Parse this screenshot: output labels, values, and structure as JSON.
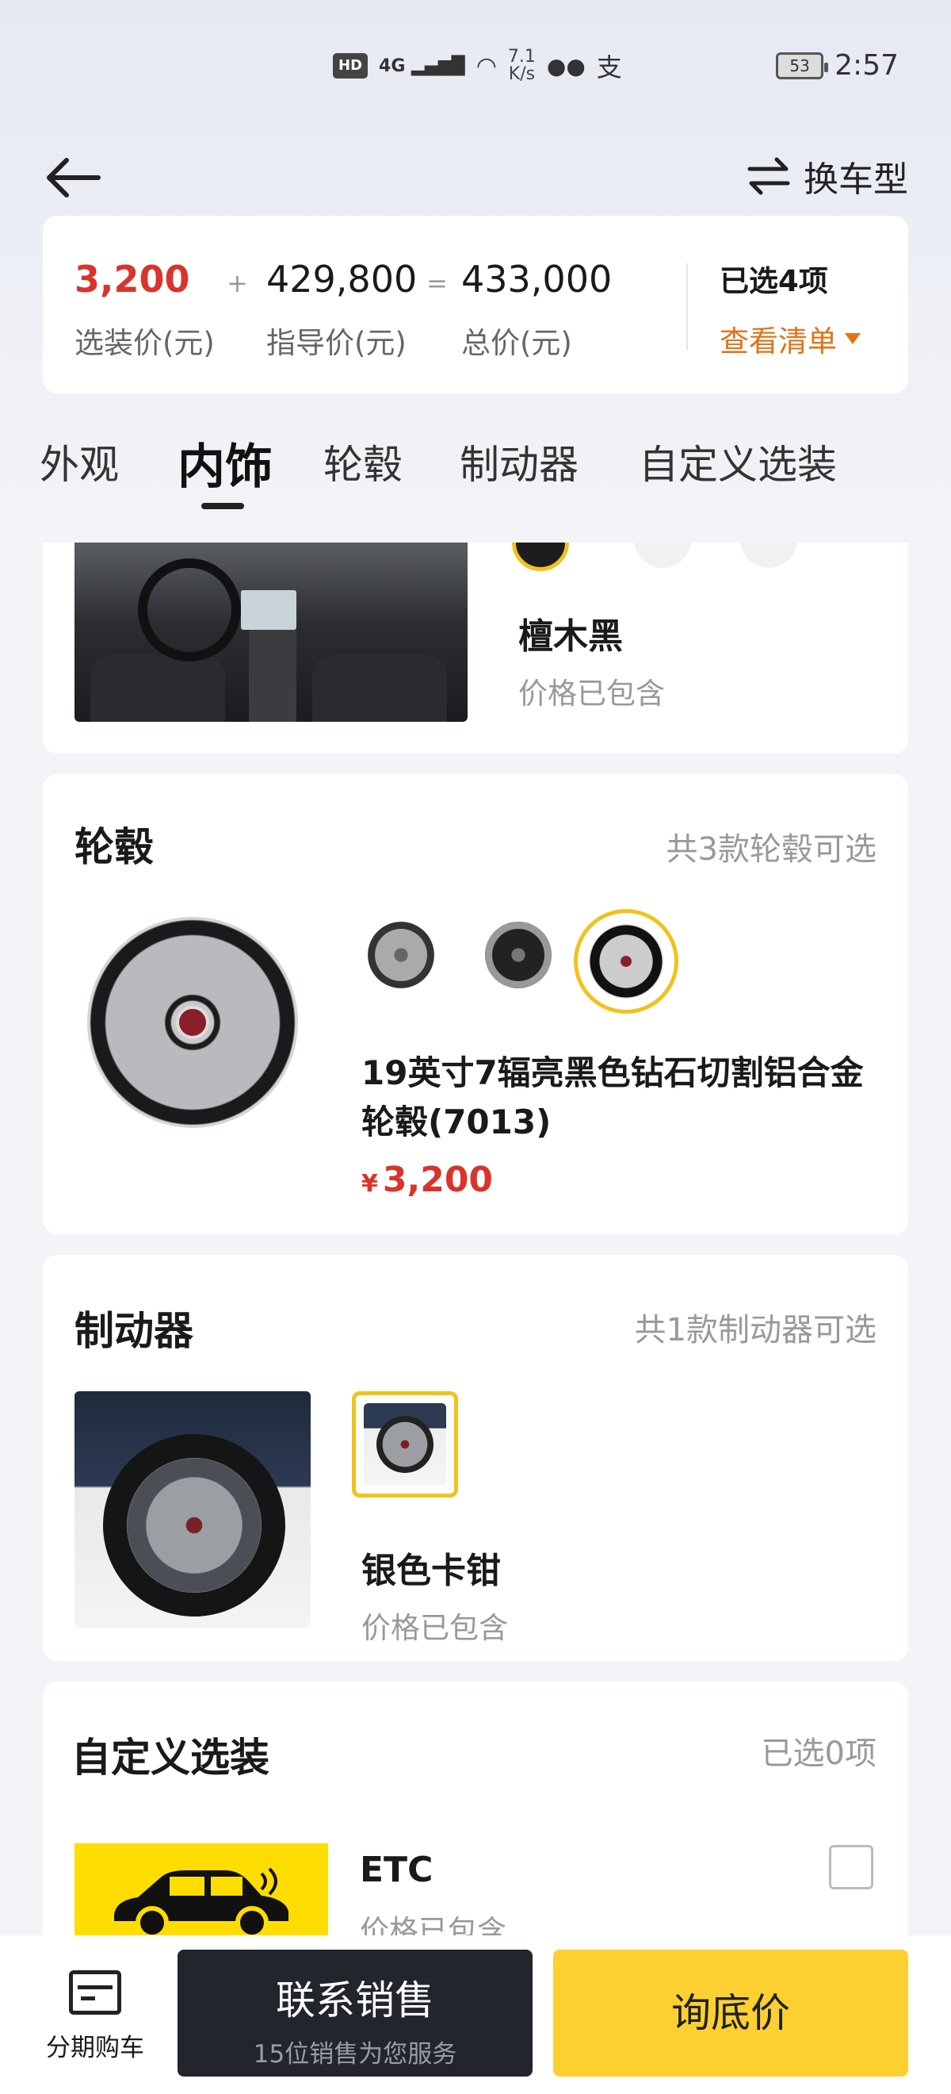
{
  "status_bar": {
    "hd": "HD",
    "signal": "4G",
    "speed_value": "7.1",
    "speed_unit": "K/s",
    "alipay": "支",
    "battery": "53",
    "time": "2:57"
  },
  "nav": {
    "back_icon": "arrow-left-icon",
    "switch_label": "换车型",
    "switch_icon": "swap-arrows-icon"
  },
  "price_summary": {
    "option_price": "3,200",
    "option_label": "选装价(元)",
    "plus": "+",
    "guide_price": "429,800",
    "guide_label": "指导价(元)",
    "equals": "=",
    "total_price": "433,000",
    "total_label": "总价(元)",
    "selected_count": "已选4项",
    "view_list": "查看清单"
  },
  "tabs": [
    "外观",
    "内饰",
    "轮毂",
    "制动器",
    "自定义选装"
  ],
  "active_tab": "内饰",
  "interior": {
    "name": "檀木黑",
    "price": "价格已包含"
  },
  "wheels": {
    "title": "轮毂",
    "hint": "共3款轮毂可选",
    "name": "19英寸7辐亮黑色钻石切割铝合金轮毂(7013)",
    "currency": "¥",
    "price": "3,200"
  },
  "brakes": {
    "title": "制动器",
    "hint": "共1款制动器可选",
    "name": "银色卡钳",
    "price": "价格已包含"
  },
  "custom": {
    "title": "自定义选装",
    "hint": "已选0项",
    "etc_name": "ETC",
    "etc_price": "价格已包含"
  },
  "bottom_bar": {
    "installment": "分期购车",
    "contact": "联系销售",
    "contact_sub": "15位销售为您服务",
    "ask_price": "询底价"
  },
  "colors": {
    "accent_red": "#d9342b",
    "accent_orange": "#e0731a",
    "selection_yellow": "#f2c21c",
    "cta_yellow": "#fdd032",
    "cta_dark": "#23252c"
  }
}
